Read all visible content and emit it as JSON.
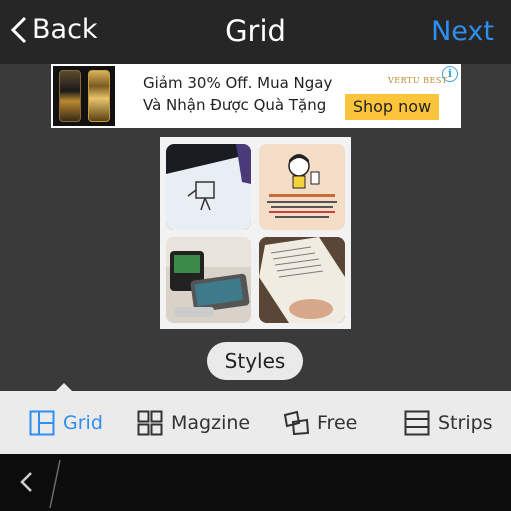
{
  "header": {
    "back_label": "Back",
    "title": "Grid",
    "next_label": "Next"
  },
  "ad": {
    "line1": "Giảm 30% Off. Mua Ngay",
    "line2": "Và Nhận Được Quà Tặng",
    "brand": "VERTU BEST",
    "cta": "Shop now",
    "info_glyph": "i"
  },
  "styles_button": {
    "label": "Styles"
  },
  "tabs": [
    {
      "label": "Grid",
      "icon": "grid-layout-icon",
      "active": true
    },
    {
      "label": "Magzine",
      "icon": "magazine-layout-icon",
      "active": false
    },
    {
      "label": "Free",
      "icon": "free-layout-icon",
      "active": false
    },
    {
      "label": "Strips",
      "icon": "strips-layout-icon",
      "active": false
    }
  ],
  "colors": {
    "accent": "#2d8ff0",
    "topbar": "#262626",
    "background": "#3a3a3a",
    "tabbar": "#ebebeb",
    "ad_button": "#fcc43a"
  }
}
